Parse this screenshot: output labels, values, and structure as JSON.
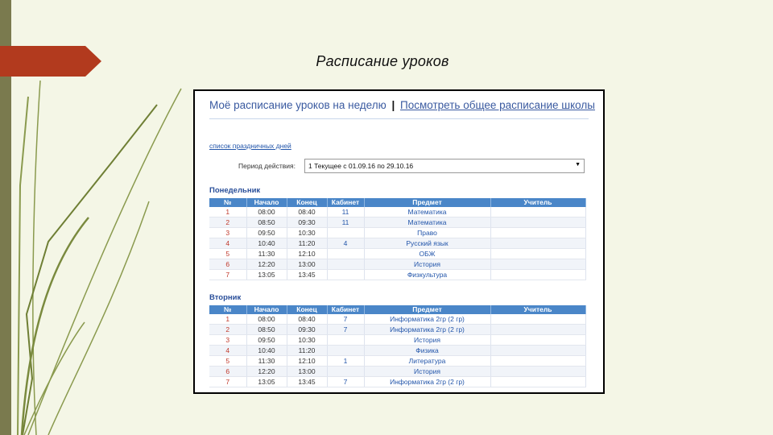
{
  "slide": {
    "title": "Расписание уроков"
  },
  "header": {
    "my_schedule": "Моё расписание уроков на неделю",
    "separator": "|",
    "school_link": "Посмотреть общее расписание школы"
  },
  "holidays_link": "список праздничных дней",
  "period": {
    "label": "Период действия:",
    "value": "1 Текущее с 01.09.16 по 29.10.16"
  },
  "columns": [
    "№",
    "Начало",
    "Конец",
    "Кабинет",
    "Предмет",
    "Учитель"
  ],
  "days": [
    {
      "name": "Понедельник",
      "rows": [
        {
          "n": "1",
          "start": "08:00",
          "end": "08:40",
          "room": "11",
          "subject": "Математика",
          "teacher": ""
        },
        {
          "n": "2",
          "start": "08:50",
          "end": "09:30",
          "room": "11",
          "subject": "Математика",
          "teacher": ""
        },
        {
          "n": "3",
          "start": "09:50",
          "end": "10:30",
          "room": "",
          "subject": "Право",
          "teacher": ""
        },
        {
          "n": "4",
          "start": "10:40",
          "end": "11:20",
          "room": "4",
          "subject": "Русский язык",
          "teacher": ""
        },
        {
          "n": "5",
          "start": "11:30",
          "end": "12:10",
          "room": "",
          "subject": "ОБЖ",
          "teacher": ""
        },
        {
          "n": "6",
          "start": "12:20",
          "end": "13:00",
          "room": "",
          "subject": "История",
          "teacher": ""
        },
        {
          "n": "7",
          "start": "13:05",
          "end": "13:45",
          "room": "",
          "subject": "Физкультура",
          "teacher": ""
        }
      ]
    },
    {
      "name": "Вторник",
      "rows": [
        {
          "n": "1",
          "start": "08:00",
          "end": "08:40",
          "room": "7",
          "subject": "Информатика 2гр (2 гр)",
          "teacher": ""
        },
        {
          "n": "2",
          "start": "08:50",
          "end": "09:30",
          "room": "7",
          "subject": "Информатика 2гр (2 гр)",
          "teacher": ""
        },
        {
          "n": "3",
          "start": "09:50",
          "end": "10:30",
          "room": "",
          "subject": "История",
          "teacher": ""
        },
        {
          "n": "4",
          "start": "10:40",
          "end": "11:20",
          "room": "",
          "subject": "Физика",
          "teacher": ""
        },
        {
          "n": "5",
          "start": "11:30",
          "end": "12:10",
          "room": "1",
          "subject": "Литература",
          "teacher": ""
        },
        {
          "n": "6",
          "start": "12:20",
          "end": "13:00",
          "room": "",
          "subject": "История",
          "teacher": ""
        },
        {
          "n": "7",
          "start": "13:05",
          "end": "13:45",
          "room": "7",
          "subject": "Информатика 2гр (2 гр)",
          "teacher": ""
        }
      ]
    }
  ],
  "colors": {
    "accent_red": "#b23a1e",
    "header_blue": "#4a86c8",
    "stripe": "#7a7a4e"
  }
}
